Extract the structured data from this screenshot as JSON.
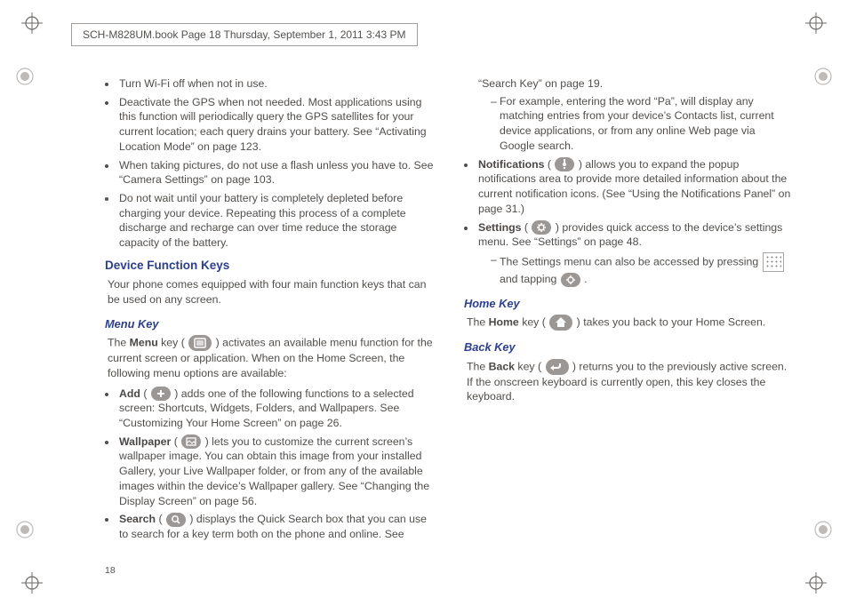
{
  "header": "SCH-M828UM.book  Page 18  Thursday, September 1, 2011  3:43 PM",
  "page_number": "18",
  "col1": {
    "bullets": [
      "Turn Wi-Fi off when not in use.",
      "Deactivate the GPS when not needed. Most applications using this function will periodically query the GPS satellites for your current location; each query drains your battery. See “Activating Location Mode” on page 123.",
      "When taking pictures, do not use a flash unless you have to. See “Camera Settings” on page 103.",
      "Do not wait until your battery is completely depleted before charging your device. Repeating this process of a complete discharge and recharge can over time reduce the storage capacity of the battery."
    ],
    "h_section": "Device Function Keys",
    "section_p": "Your phone comes equipped with four main function keys that can be used on any screen.",
    "h_menu": "Menu Key",
    "menu_p_pre": "The ",
    "menu_bold": "Menu",
    "menu_p_mid": " key ( ",
    "menu_p_post": " ) activates an available menu function for the current screen or application. When on the Home Screen, the following menu options are available:",
    "add_bold": "Add",
    "add_text": " ( ",
    "add_post": " ) adds one of the following functions to a selected screen: Shortcuts, Widgets, Folders, and Wallpapers. See “Customizing Your Home Screen” on page 26."
  },
  "col2": {
    "wallpaper_bold": "Wallpaper",
    "wallpaper_text": " ( ",
    "wallpaper_post": " ) lets you to customize the current screen’s wallpaper image. You can obtain this image from your installed Gallery, your Live Wallpaper folder, or from any of the available images within the device’s Wallpaper gallery. See “Changing the Display Screen” on page 56.",
    "search_bold": "Search",
    "search_text": " ( ",
    "search_post": " ) displays the Quick Search box that you can use to search for a key term both on the phone and online. See “Search Key” on page 19.",
    "search_sub": "For example, entering the word “Pa”, will display any matching entries from your device’s Contacts list, current device applications, or from any online Web page via Google search.",
    "notif_bold": "Notifications",
    "notif_text": " ( ",
    "notif_post": " ) allows you to expand the popup notifications area to provide more detailed information about the current notification icons. (See “Using the Notifications Panel” on page 31.)",
    "settings_bold": "Settings",
    "settings_text": " ( ",
    "settings_post": " ) provides quick access to the device’s settings menu. See “Settings” on page 48.",
    "settings_sub_pre": "The Settings menu can also be accessed by pressing ",
    "settings_sub_mid": " and tapping ",
    "settings_sub_post": " .",
    "h_home": "Home Key",
    "home_pre": "The ",
    "home_bold": "Home",
    "home_mid": " key ( ",
    "home_post": " ) takes you back to your Home Screen.",
    "h_back": "Back Key",
    "back_pre": "The ",
    "back_bold": "Back",
    "back_mid": " key ( ",
    "back_post": " ) returns you to the previously active screen. If the onscreen keyboard is currently open, this key closes the keyboard."
  }
}
